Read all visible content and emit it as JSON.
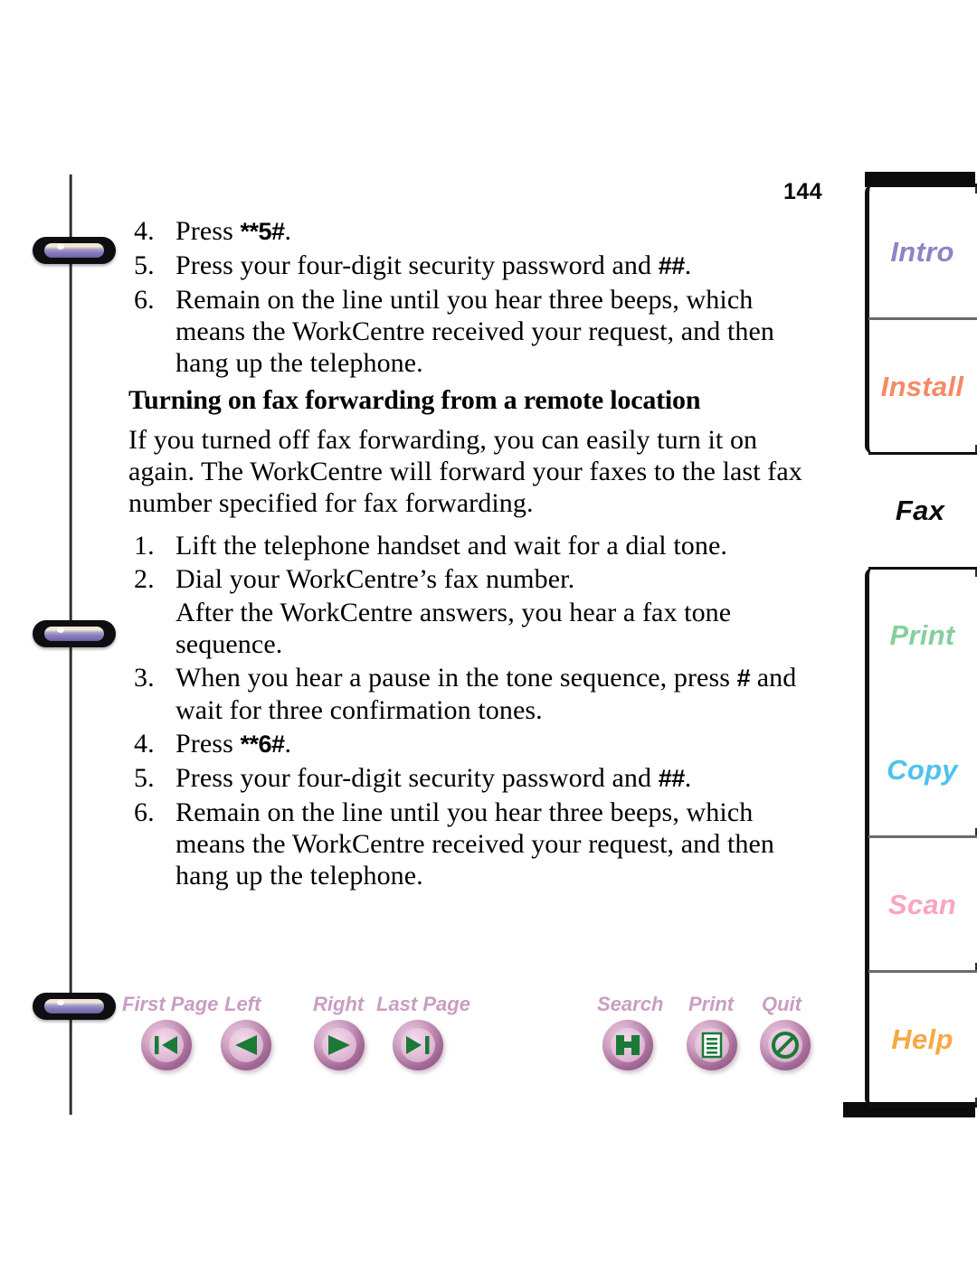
{
  "document": {
    "page_number": "144",
    "selected_tab": "Fax"
  },
  "content": {
    "steps_top": [
      {
        "num": "4.",
        "pre": "Press ",
        "key": "**5#",
        "post": "."
      },
      {
        "num": "5.",
        "pre": "Press your four-digit security password and ",
        "key": "##",
        "post": "."
      },
      {
        "num": "6.",
        "pre": "Remain on the line until you hear three beeps, which means the WorkCentre received your request, and then hang up the telephone.",
        "key": "",
        "post": ""
      }
    ],
    "heading": "Turning on fax forwarding from a remote location",
    "intro_paragraph": "If you turned off fax forwarding, you can easily turn it on again. The WorkCentre will forward your faxes to the last fax number specified for fax forwarding.",
    "steps_bottom": [
      {
        "num": "1.",
        "pre": "Lift the telephone handset and wait for a dial tone.",
        "key": "",
        "post": ""
      },
      {
        "num": "2.",
        "pre": "Dial your WorkCentre’s fax number.",
        "key": "",
        "post": ""
      },
      {
        "num": "3.",
        "pre": "When you hear a pause in the tone sequence, press ",
        "key": "#",
        "post": " and wait for three confirmation tones."
      },
      {
        "num": "4.",
        "pre": "Press ",
        "key": "**6#",
        "post": "."
      },
      {
        "num": "5.",
        "pre": "Press your four-digit security password and ",
        "key": "##",
        "post": "."
      },
      {
        "num": "6.",
        "pre": "Remain on the line until you hear three beeps, which means the WorkCentre received your request, and then hang up the telephone.",
        "key": "",
        "post": ""
      }
    ],
    "substep_after_2": "After the WorkCentre answers, you hear a fax tone sequence."
  },
  "tabs": {
    "group_top": [
      {
        "label": "Intro",
        "color": "#8b85c6"
      },
      {
        "label": "Install",
        "color": "#f58a68"
      }
    ],
    "selected": {
      "label": "Fax",
      "color": "#0b0b0b"
    },
    "group_bottom": [
      {
        "label": "Print",
        "color": "#86cf9c"
      },
      {
        "label": "Copy",
        "color": "#4cc3ec"
      },
      {
        "label": "Scan",
        "color": "#f9a6bd"
      },
      {
        "label": "Help",
        "color": "#f9a845"
      }
    ]
  },
  "toolbar": {
    "label_color": "#c99ec2",
    "glyph_color": "#1a7a36",
    "buttons": [
      {
        "label": "First Page",
        "icon": "first-page-icon"
      },
      {
        "label": "Left",
        "icon": "previous-page-icon"
      },
      {
        "label": "Right",
        "icon": "next-page-icon"
      },
      {
        "label": "Last Page",
        "icon": "last-page-icon"
      },
      {
        "label": "Search",
        "icon": "search-icon"
      },
      {
        "label": "Print",
        "icon": "print-icon"
      },
      {
        "label": "Quit",
        "icon": "quit-icon"
      }
    ]
  },
  "binder": {
    "rings": 3
  }
}
